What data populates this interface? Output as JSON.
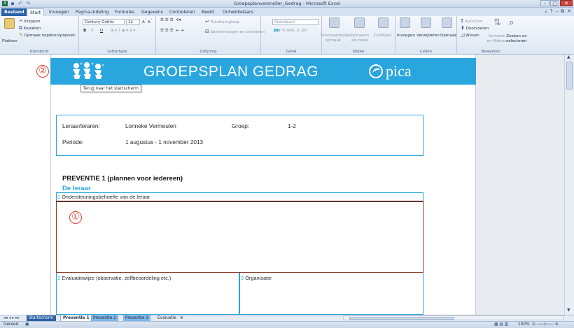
{
  "window": {
    "title": "Groepsplanversneller_Gedrag - Microsoft Excel"
  },
  "ribbon_tabs": [
    "Bestand",
    "Start",
    "Invoegen",
    "Pagina-indeling",
    "Formules",
    "Gegevens",
    "Controleren",
    "Beeld",
    "Ontwikkelaars"
  ],
  "ribbon": {
    "clipboard": {
      "paste": "Plakken",
      "cut": "Knippen",
      "copy": "Kopiëren",
      "format_painter": "Opmaak kopiëren/plakken",
      "label": "Klembord"
    },
    "font": {
      "font_name": "Century Gothic",
      "font_size": "12",
      "bold": "B",
      "italic": "I",
      "underline": "U",
      "label": "Lettertype"
    },
    "alignment": {
      "wrap": "Tekstterugloop",
      "merge": "Samenvoegen en centreren",
      "label": "Uitlijning"
    },
    "number": {
      "format": "Standaard",
      "label": "Getal"
    },
    "styles": {
      "conditional": "Voorwaardelijke opmaak",
      "as_table": "Opmaken als tabel",
      "cell_styles": "Celstijlen",
      "label": "Stijlen"
    },
    "cells": {
      "insert": "Invoegen",
      "delete": "Verwijderen",
      "format": "Opmaak",
      "label": "Cellen"
    },
    "editing": {
      "autosum": "AutoSom",
      "fill": "Doorvoeren",
      "clear": "Wissen",
      "sort": "Sorteren en filteren",
      "find": "Zoeken en selecteren",
      "label": "Bewerken"
    }
  },
  "banner": {
    "title": "GROEPSPLAN GEDRAG",
    "brand": "pica",
    "tooltip": "Terug naar het startscherm"
  },
  "markers": {
    "one": "①",
    "two": "②"
  },
  "info": {
    "teacher_label": "Leraar/leraren:",
    "teacher_value": "Lonneke Vermeulen",
    "group_label": "Groep:",
    "group_value": "1-2",
    "period_label": "Periode:",
    "period_value": "1 augustus - 1 november 2013"
  },
  "section": {
    "title": "PREVENTIE 1 (plannen voor iedereen)",
    "subtitle": "De leraar",
    "box1_num": "1",
    "box1_label": "Ondersteuningsbehoefte van de leraar",
    "box2_num": "2",
    "box2_label": "Evaluatiewijze (observatie, zelfbeoordeling etc.)",
    "box3_num": "3",
    "box3_label": "Organisatie"
  },
  "sheet_tabs": [
    "Startscherm",
    "Preventie 1",
    "Preventie 2",
    "Preventie 3",
    "Evaluatie"
  ],
  "status": {
    "ready": "Gereed",
    "zoom": "100%"
  }
}
